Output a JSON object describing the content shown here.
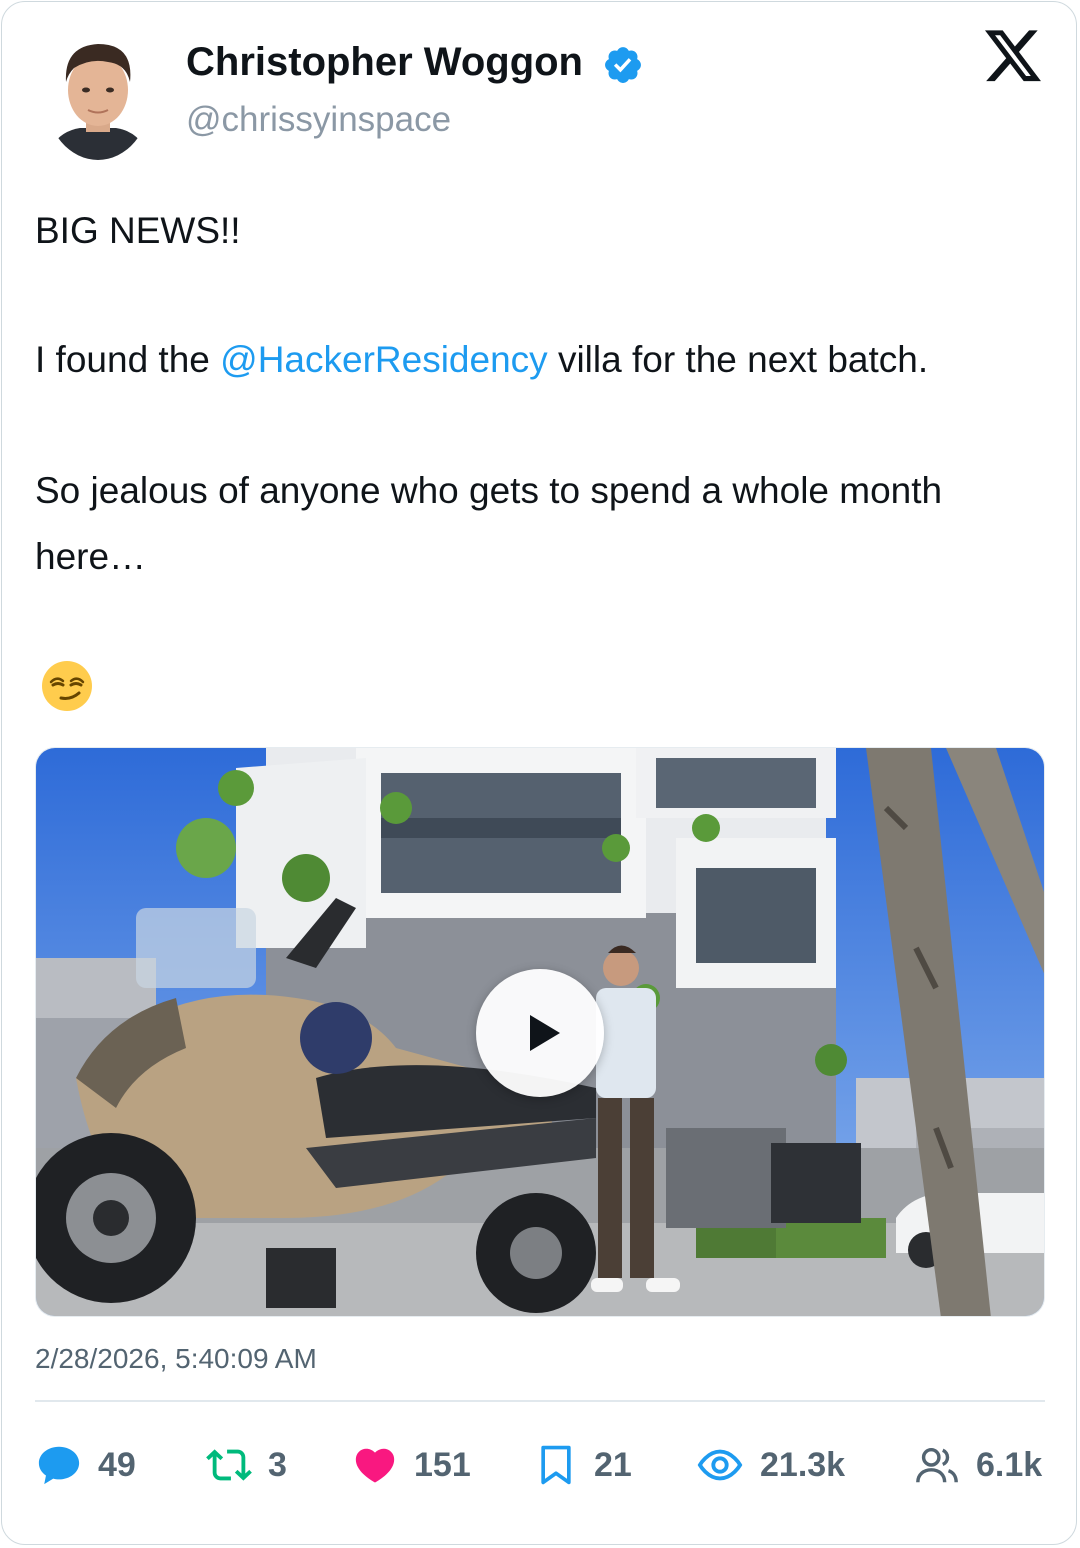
{
  "author": {
    "name": "Christopher Woggon",
    "handle": "@chrissyinspace",
    "verified_icon": "verified-badge-icon",
    "accent": "#1d9bf0"
  },
  "tweet": {
    "line1": "BIG NEWS!!",
    "line2_before": "I found the ",
    "line2_mention": "@HackerResidency",
    "line2_after": " villa for the next batch.",
    "line3": "So jealous of anyone who gets to spend a whole month",
    "line4": "here…",
    "emoji": "smirking-face"
  },
  "media": {
    "type": "video",
    "play_icon": "play-icon"
  },
  "timestamp": "2/28/2026, 5:40:09 AM",
  "stats": {
    "replies": "49",
    "retweets": "3",
    "likes": "151",
    "bookmarks": "21",
    "views": "21.3k",
    "followers": "6.1k"
  },
  "colors": {
    "reply": "#1d9bf0",
    "retweet": "#00ba7c",
    "like": "#f91880",
    "bookmark": "#1d9bf0",
    "views": "#1d9bf0",
    "followers": "#536471"
  }
}
